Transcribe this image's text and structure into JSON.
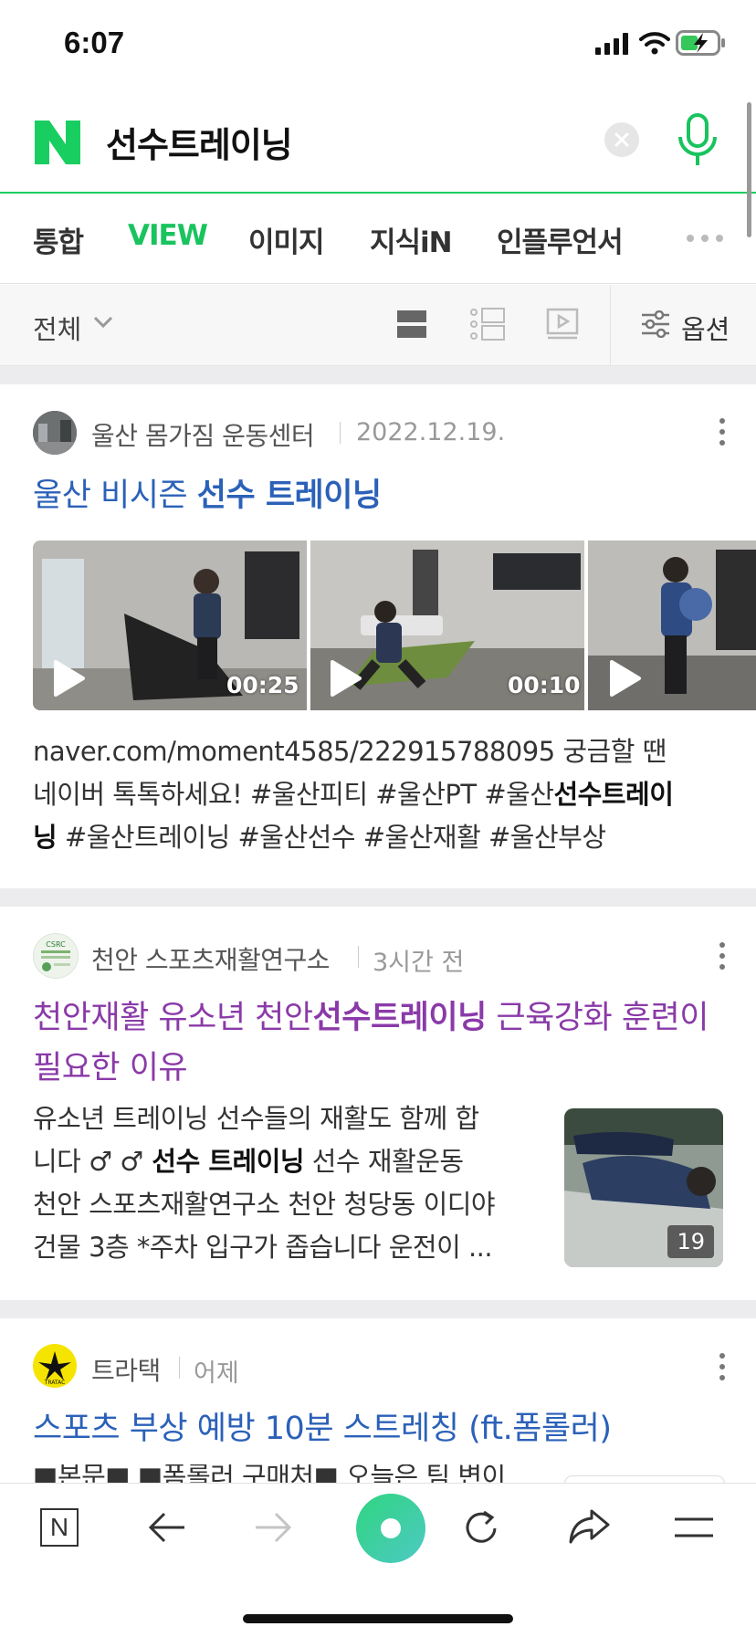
{
  "status_bar": {
    "time": "6:07"
  },
  "search": {
    "query": "선수트레이닝"
  },
  "tabs": [
    {
      "label": "통합",
      "active": false
    },
    {
      "label": "VIEW",
      "active": true
    },
    {
      "label": "이미지",
      "active": false
    },
    {
      "label": "지식iN",
      "active": false
    },
    {
      "label": "인플루언서",
      "active": false
    }
  ],
  "filter": {
    "scope_label": "전체",
    "options_label": "옵션"
  },
  "results": [
    {
      "author": "울산 몸가짐 운동센터",
      "date": "2022.12.19.",
      "title_prefix": "울산 비시즌 ",
      "title_bold": "선수 트레이닝",
      "videos": [
        {
          "duration": "00:25"
        },
        {
          "duration": "00:10"
        },
        {
          "duration": ""
        }
      ],
      "desc_line1": "naver.com/moment4585/222915788095 궁금할 땐",
      "desc_line2_pre": "네이버 톡톡하세요! #울산피티 #울산PT #울산",
      "desc_line2_bold": "선수트레이",
      "desc_line3_bold": "닝",
      "desc_line3_post": " #울산트레이닝 #울산선수 #울산재활 #울산부상"
    },
    {
      "author": "천안 스포츠재활연구소",
      "date": "3시간 전",
      "title_line1_pre": "천안재활 유소년 천안",
      "title_line1_bold": "선수트레이닝",
      "title_line1_post": " 근육강화 훈련이",
      "title_line2": "필요한 이유",
      "desc_line1": "유소년 트레이닝 선수들의 재활도 함께 합",
      "desc_line2_pre": "니다 ",
      "desc_line2_symbols": "♂ ♂",
      "desc_line2_bold": " 선수 트레이닝",
      "desc_line2_post": " 선수 재활운동",
      "desc_line3": "천안 스포츠재활연구소 천안 청당동 이디야",
      "desc_line4": "건물 3층 *주차 입구가 좁습니다 운전이 ...",
      "image_count": "19"
    },
    {
      "author": "트라택",
      "date": "어제",
      "title": "스포츠 부상 예방 10분 스트레칭 (ft.폼롤러)",
      "desc_partial": "■본문■ ■폼롤러 구매처■ 오늘은 팀 변이"
    }
  ],
  "bottom_bar": {
    "home_letter": "N"
  },
  "colors": {
    "naver_green": "#19ce60",
    "link_blue": "#2b61b8",
    "visited_purple": "#8a3aa8"
  }
}
